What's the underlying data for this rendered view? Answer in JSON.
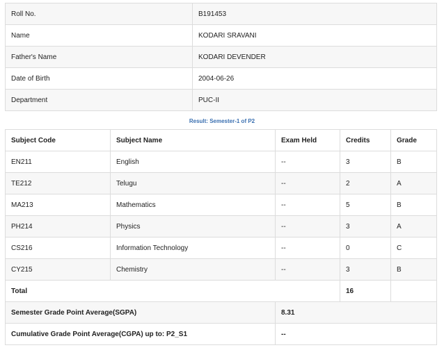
{
  "student": {
    "rows": [
      {
        "label": "Roll No.",
        "value": "B191453"
      },
      {
        "label": "Name",
        "value": "KODARI SRAVANI"
      },
      {
        "label": "Father's Name",
        "value": "KODARI DEVENDER"
      },
      {
        "label": "Date of Birth",
        "value": "2004-06-26"
      },
      {
        "label": "Department",
        "value": "PUC-II"
      }
    ]
  },
  "result": {
    "caption": "Result: Semester-1 of P2",
    "headers": {
      "code": "Subject Code",
      "name": "Subject Name",
      "exam": "Exam Held",
      "credits": "Credits",
      "grade": "Grade"
    },
    "subjects": [
      {
        "code": "EN211",
        "name": "English",
        "exam": "--",
        "credits": "3",
        "grade": "B"
      },
      {
        "code": "TE212",
        "name": "Telugu",
        "exam": "--",
        "credits": "2",
        "grade": "A"
      },
      {
        "code": "MA213",
        "name": "Mathematics",
        "exam": "--",
        "credits": "5",
        "grade": "B"
      },
      {
        "code": "PH214",
        "name": "Physics",
        "exam": "--",
        "credits": "3",
        "grade": "A"
      },
      {
        "code": "CS216",
        "name": "Information Technology",
        "exam": "--",
        "credits": "0",
        "grade": "C"
      },
      {
        "code": "CY215",
        "name": "Chemistry",
        "exam": "--",
        "credits": "3",
        "grade": "B"
      }
    ],
    "total": {
      "label": "Total",
      "credits": "16"
    },
    "sgpa": {
      "label": "Semester Grade Point Average(SGPA)",
      "value": "8.31"
    },
    "cgpa": {
      "label": "Cumulative Grade Point Average(CGPA) up to: P2_S1",
      "value": "--"
    }
  }
}
